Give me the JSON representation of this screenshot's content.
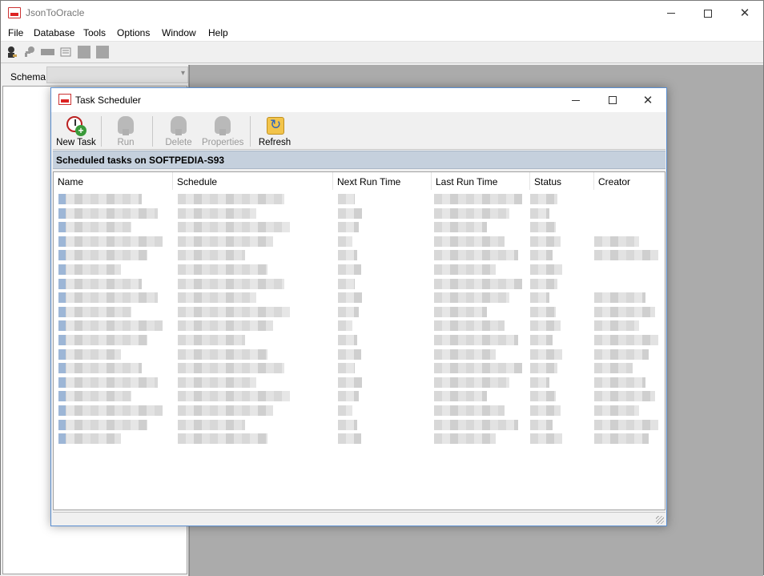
{
  "app": {
    "title": "JsonToOracle",
    "menu": [
      "File",
      "Database",
      "Tools",
      "Options",
      "Window",
      "Help"
    ],
    "toolbar_icons": [
      "connect-icon",
      "key-icon",
      "disconnect-icon",
      "query-icon",
      "grid-icon",
      "grid-icon"
    ],
    "schema_label": "Schema",
    "schema_value": ""
  },
  "dialog": {
    "title": "Task Scheduler",
    "toolbar": [
      {
        "label": "New Task",
        "icon": "new-task-icon",
        "enabled": true
      },
      {
        "label": "Run",
        "icon": "run-icon",
        "enabled": false
      },
      {
        "label": "Delete",
        "icon": "delete-icon",
        "enabled": false
      },
      {
        "label": "Properties",
        "icon": "properties-icon",
        "enabled": false
      },
      {
        "label": "Refresh",
        "icon": "refresh-icon",
        "enabled": true
      }
    ],
    "banner": "Scheduled tasks on SOFTPEDIA-S93",
    "columns": [
      "Name",
      "Schedule",
      "Next Run Time",
      "Last Run Time",
      "Status",
      "Creator"
    ]
  },
  "colors": {
    "banner_bg": "#c5d0dd",
    "dialog_border": "#5a8ed0",
    "mdi_bg": "#ababab"
  }
}
